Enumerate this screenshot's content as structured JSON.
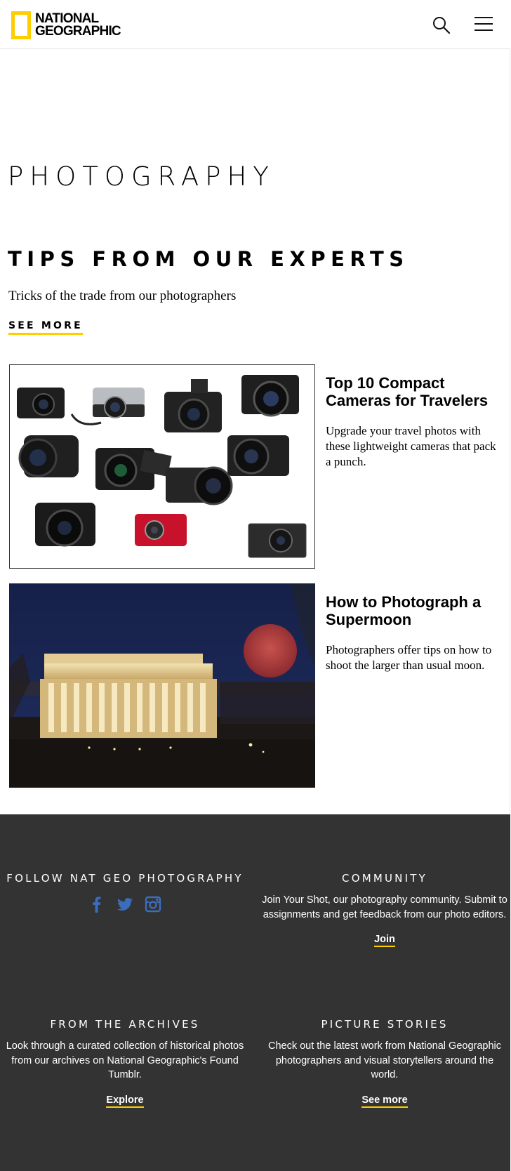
{
  "header": {
    "logo_line1": "NATIONAL",
    "logo_line2": "GEOGRAPHIC",
    "icons": [
      "search-icon",
      "hamburger-menu-icon"
    ],
    "brand_color": "#ffce00"
  },
  "main": {
    "page_title": "PHOTOGRAPHY",
    "section_title": "TIPS FROM OUR EXPERTS",
    "section_dek": "Tricks of the trade from our photographers",
    "see_more": "SEE MORE",
    "articles": [
      {
        "headline": "Top 10 Compact Cameras for Travelers",
        "dek": "Upgrade your travel photos with these lightweight cameras that pack a punch."
      },
      {
        "headline": "How to Photograph a Supermoon",
        "dek": "Photographers offer tips on how to shoot the larger than usual moon."
      }
    ]
  },
  "footer": {
    "background": "#333333",
    "follow": {
      "title": "FOLLOW NAT GEO PHOTOGRAPHY",
      "social_icons": [
        "facebook-icon",
        "twitter-icon",
        "instagram-icon"
      ],
      "social_color": "#3b6dbd"
    },
    "community": {
      "title": "COMMUNITY",
      "text": "Join Your Shot, our photography community. Submit to assignments and get feedback from our photo editors.",
      "link": "Join"
    },
    "archives": {
      "title": "FROM THE ARCHIVES",
      "text": "Look through a curated collection of historical photos from our archives on National Geographic's Found Tumblr.",
      "link": "Explore"
    },
    "picture_stories": {
      "title": "PICTURE STORIES",
      "text": "Check out the latest work from National Geographic photographers and visual storytellers around the world.",
      "link": "See more"
    }
  }
}
